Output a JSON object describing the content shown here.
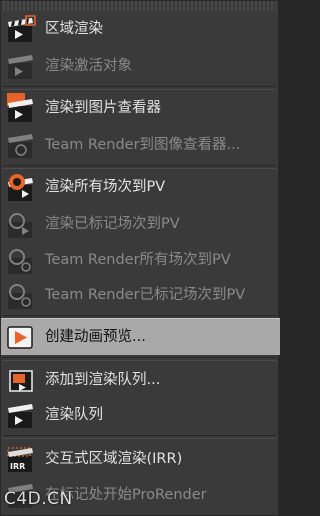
{
  "menu": {
    "items": [
      {
        "label": "区域渲染",
        "icon": "clapperboard-region-icon",
        "enabled": true
      },
      {
        "label": "渲染激活对象",
        "icon": "clapperboard-object-icon",
        "enabled": false
      },
      {
        "label": "渲染到图片查看器",
        "icon": "clapperboard-picture-viewer-icon",
        "enabled": true
      },
      {
        "label": "Team Render到图像查看器...",
        "icon": "team-render-viewer-icon",
        "enabled": false
      },
      {
        "label": "渲染所有场次到PV",
        "icon": "render-all-takes-icon",
        "enabled": true
      },
      {
        "label": "渲染已标记场次到PV",
        "icon": "render-marked-takes-icon",
        "enabled": false
      },
      {
        "label": "Team Render所有场次到PV",
        "icon": "team-render-all-takes-icon",
        "enabled": false
      },
      {
        "label": "Team Render已标记场次到PV",
        "icon": "team-render-marked-takes-icon",
        "enabled": false
      },
      {
        "label": "创建动画预览...",
        "icon": "make-preview-play-icon",
        "enabled": true,
        "highlighted": true
      },
      {
        "label": "添加到渲染队列...",
        "icon": "add-to-render-queue-icon",
        "enabled": true
      },
      {
        "label": "渲染队列",
        "icon": "render-queue-icon",
        "enabled": true
      },
      {
        "label": "交互式区域渲染(IRR)",
        "icon": "interactive-region-render-icon",
        "enabled": true
      },
      {
        "label": "在标记处开始ProRender",
        "icon": "prorender-icon",
        "enabled": false
      }
    ]
  },
  "watermark": "C4D.CN",
  "colors": {
    "accent_orange": "#e8632a",
    "highlight": "#a9a9a9",
    "menu_bg": "#3a3a3a"
  }
}
